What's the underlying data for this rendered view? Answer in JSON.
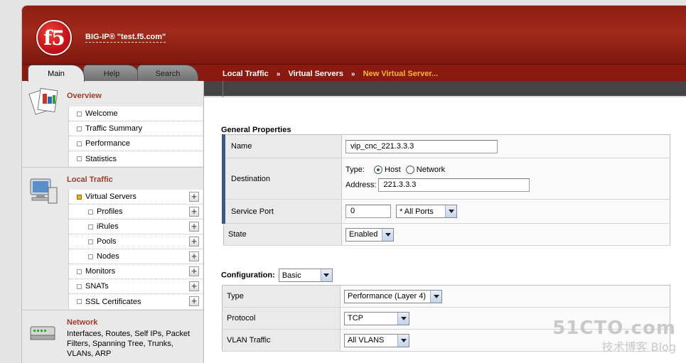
{
  "header": {
    "logo_text": "f5",
    "hostname": "BIG-IP® \"test.f5.com\""
  },
  "tabs": [
    {
      "label": "Main"
    },
    {
      "label": "Help"
    },
    {
      "label": "Search"
    }
  ],
  "breadcrumb": [
    "Local Traffic",
    "Virtual Servers",
    "New Virtual Server..."
  ],
  "breadcrumb_separator": "»",
  "sidebar": {
    "overview": {
      "title": "Overview",
      "items": [
        {
          "label": "Welcome"
        },
        {
          "label": "Traffic Summary"
        },
        {
          "label": "Performance"
        },
        {
          "label": "Statistics"
        }
      ]
    },
    "local_traffic": {
      "title": "Local Traffic",
      "items": [
        {
          "label": "Virtual Servers"
        },
        {
          "label": "Profiles"
        },
        {
          "label": "iRules"
        },
        {
          "label": "Pools"
        },
        {
          "label": "Nodes"
        },
        {
          "label": "Monitors"
        },
        {
          "label": "SNATs"
        },
        {
          "label": "SSL Certificates"
        }
      ]
    },
    "network": {
      "title": "Network",
      "description": "Interfaces, Routes, Self IPs, Packet Filters, Spanning Tree, Trunks, VLANs, ARP"
    },
    "plus_symbol": "+"
  },
  "general": {
    "heading": "General Properties",
    "name_label": "Name",
    "name_value": "vip_cnc_221.3.3.3",
    "destination_label": "Destination",
    "type_label": "Type:",
    "type_host": "Host",
    "type_network": "Network",
    "address_label": "Address:",
    "address_value": "221.3.3.3",
    "service_port_label": "Service Port",
    "service_port_value": "0",
    "service_port_select": "* All Ports",
    "state_label": "State",
    "state_value": "Enabled"
  },
  "configuration": {
    "heading": "Configuration:",
    "mode_value": "Basic",
    "type_label": "Type",
    "type_value": "Performance (Layer 4)",
    "protocol_label": "Protocol",
    "protocol_value": "TCP",
    "vlan_label": "VLAN Traffic",
    "vlan_value": "All VLANS"
  },
  "watermark": {
    "line1": "51CTO.com",
    "line2": "技术博客 Blog"
  }
}
